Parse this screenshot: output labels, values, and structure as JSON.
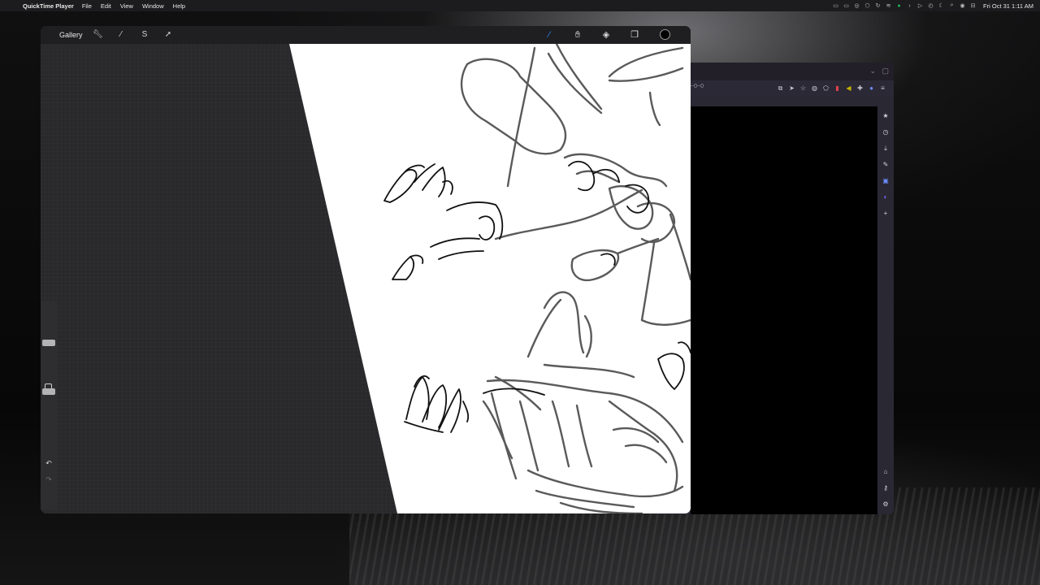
{
  "menubar": {
    "app_name": "QuickTime Player",
    "menus": [
      "File",
      "Edit",
      "View",
      "Window",
      "Help"
    ],
    "clock": "Fri Oct 31  1:11 AM"
  },
  "browser": {
    "url_fragment": "~0~0"
  },
  "procreate": {
    "gallery_label": "Gallery",
    "active_tool": "brush",
    "current_color": "#000000",
    "accent_color": "#2f8bff"
  }
}
